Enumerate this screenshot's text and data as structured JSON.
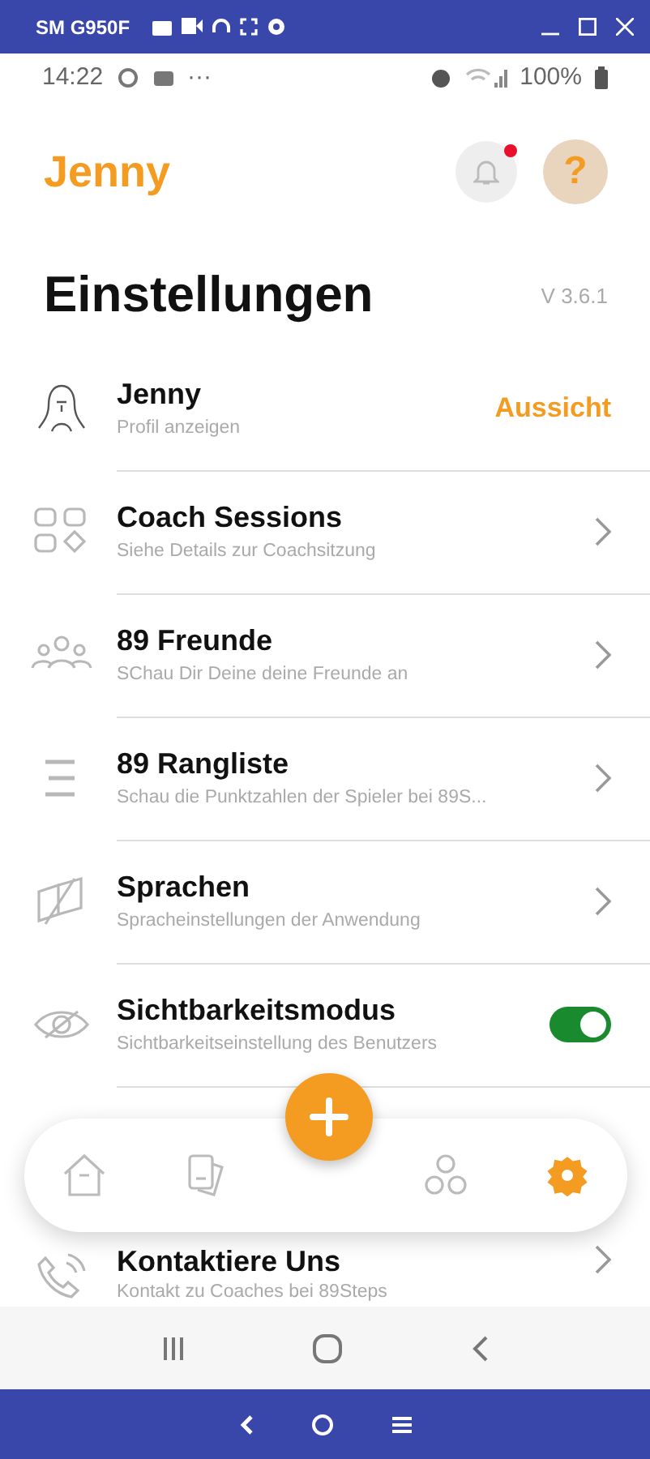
{
  "emulator_bar": {
    "title": "SM G950F"
  },
  "status_bar": {
    "time": "14:22",
    "more": "···",
    "battery": "100%"
  },
  "header": {
    "title": "Jenny",
    "notification_badge": true,
    "help": "?"
  },
  "page": {
    "title": "Einstellungen",
    "version": "V 3.6.1"
  },
  "rows": [
    {
      "kind": "profile",
      "title": "Jenny",
      "subtitle": "Profil anzeigen",
      "action": "Aussicht"
    },
    {
      "kind": "link",
      "title": "Coach Sessions",
      "subtitle": "Siehe Details zur Coachsitzung"
    },
    {
      "kind": "link",
      "title": "89 Freunde",
      "subtitle": "SChau Dir Deine deine Freunde an"
    },
    {
      "kind": "link",
      "title": "89 Rangliste",
      "subtitle": "Schau die Punktzahlen der Spieler bei 89S..."
    },
    {
      "kind": "link",
      "title": "Sprachen",
      "subtitle": "Spracheinstellungen der Anwendung"
    },
    {
      "kind": "toggle",
      "title": "Sichtbarkeitsmodus",
      "subtitle": "Sichtbarkeitseinstellung des Benutzers",
      "on": true
    },
    {
      "kind": "link",
      "title": "Kontaktiere Uns",
      "subtitle": "Kontakt zu Coaches bei 89Steps"
    }
  ],
  "bottom_nav": [
    {
      "selected": false
    },
    {
      "selected": false
    },
    {
      "selected": false
    },
    {
      "selected": false
    },
    {
      "selected": true
    }
  ]
}
